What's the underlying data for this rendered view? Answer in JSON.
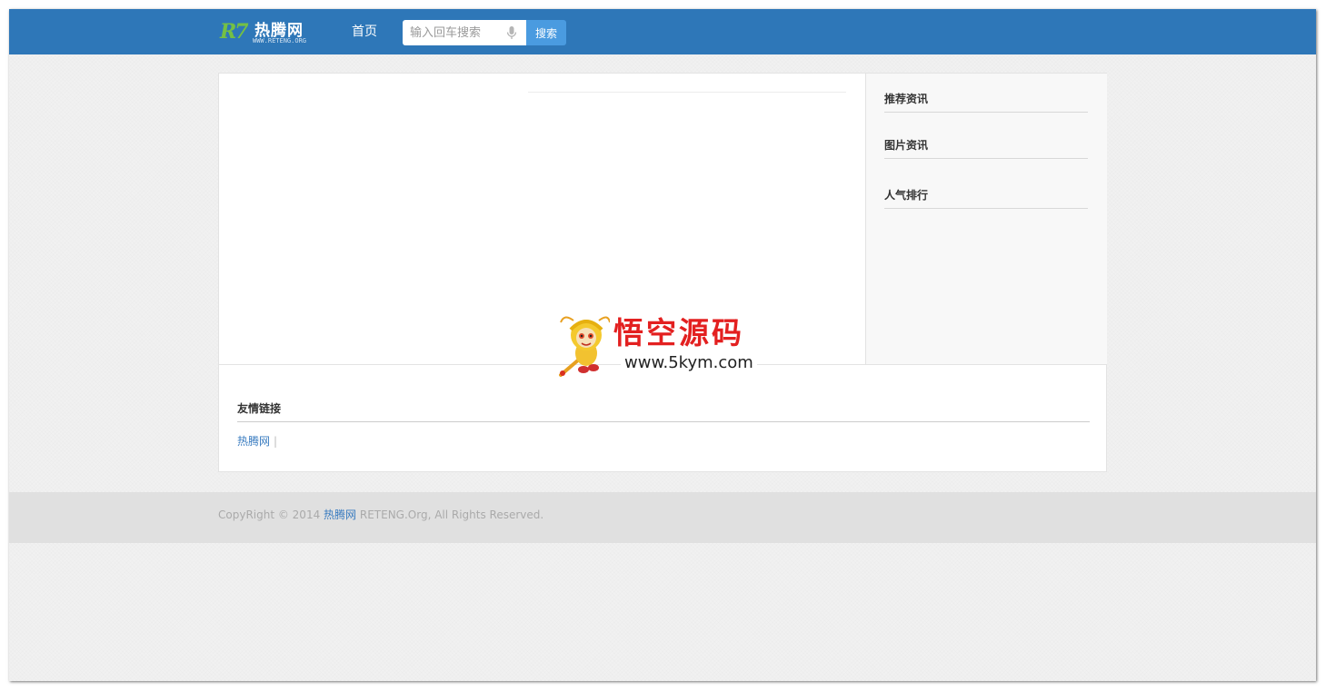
{
  "header": {
    "logo_mark": "R7",
    "logo_name": "热腾网",
    "logo_url": "WWW.RETENG.ORG",
    "nav_home": "首页",
    "search_placeholder": "输入回车搜索",
    "search_button": "搜索",
    "bar_color": "#2e77b8"
  },
  "sidebar": {
    "sections": [
      {
        "title": "推荐资讯"
      },
      {
        "title": "图片资讯"
      },
      {
        "title": "人气排行"
      }
    ]
  },
  "friend_links": {
    "title": "友情链接",
    "items": [
      {
        "label": "热腾网",
        "separator": "|"
      }
    ]
  },
  "watermark": {
    "title": "悟空源码",
    "url": "www.5kym.com"
  },
  "footer": {
    "prefix": "CopyRight © 2014 ",
    "site_link": "热腾网",
    "suffix": " RETENG.Org, All Rights Reserved."
  },
  "icons": {
    "search_mic": "microphone-icon"
  }
}
